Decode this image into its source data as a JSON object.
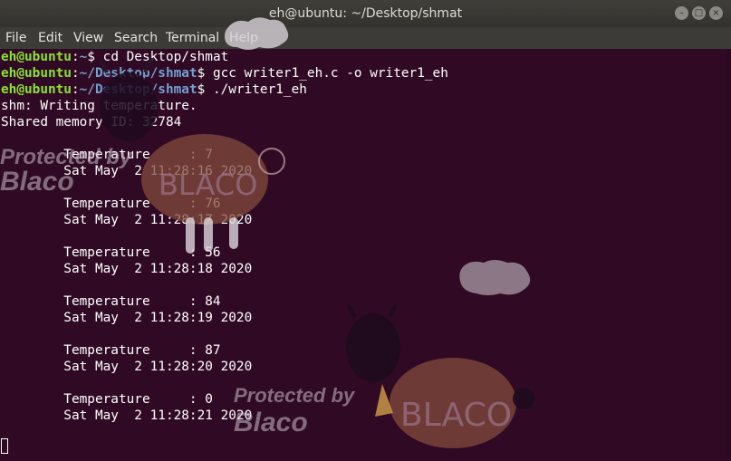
{
  "window": {
    "title": "eh@ubuntu: ~/Desktop/shmat",
    "buttons": [
      "minimize",
      "maximize",
      "close"
    ]
  },
  "menu": [
    "File",
    "Edit",
    "View",
    "Search",
    "Terminal",
    "Help"
  ],
  "terminal": {
    "prompts": [
      {
        "user": "eh@ubuntu",
        "sep": ":",
        "path": "~",
        "sign": "$ ",
        "cmd": "cd Desktop/shmat"
      },
      {
        "user": "eh@ubuntu",
        "sep": ":",
        "path": "~/Desktop/shmat",
        "sign": "$ ",
        "cmd": "gcc writer1_eh.c -o writer1_eh"
      },
      {
        "user": "eh@ubuntu",
        "sep": ":",
        "path": "~/Desktop/shmat",
        "sign": "$ ",
        "cmd": "./writer1_eh"
      }
    ],
    "output": [
      "shm: Writing temperature.",
      "Shared memory ID: 32784"
    ],
    "readings": [
      {
        "temp": "        Temperature     : 7",
        "time": "        Sat May  2 11:28:16 2020"
      },
      {
        "temp": "        Temperature     : 76",
        "time": "        Sat May  2 11:28:17 2020"
      },
      {
        "temp": "        Temperature     : 56",
        "time": "        Sat May  2 11:28:18 2020"
      },
      {
        "temp": "        Temperature     : 84",
        "time": "        Sat May  2 11:28:19 2020"
      },
      {
        "temp": "        Temperature     : 87",
        "time": "        Sat May  2 11:28:20 2020"
      },
      {
        "temp": "        Temperature     : 0",
        "time": "        Sat May  2 11:28:21 2020"
      }
    ]
  },
  "watermarks": {
    "protected_by": "Protected by",
    "brand": "Blaco",
    "sheep_label": "BLACO"
  },
  "colors": {
    "background": "#300a24",
    "user": "#8ae234",
    "path": "#729fcf",
    "text": "#ffffff"
  }
}
